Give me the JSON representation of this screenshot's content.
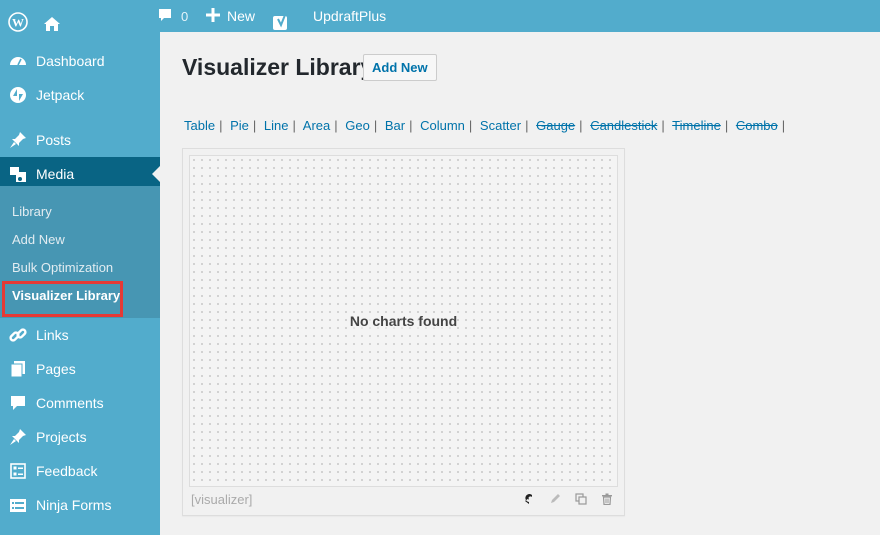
{
  "adminbar": {
    "comments_count": "0",
    "new_label": "New",
    "updraft_label": "UpdraftPlus"
  },
  "sidebar": {
    "items": [
      {
        "label": "Dashboard",
        "icon": "dashboard-icon"
      },
      {
        "label": "Jetpack",
        "icon": "jetpack-icon"
      },
      {
        "label": "Posts",
        "icon": "pin-icon"
      },
      {
        "label": "Media",
        "icon": "media-icon"
      },
      {
        "label": "Links",
        "icon": "link-icon"
      },
      {
        "label": "Pages",
        "icon": "pages-icon"
      },
      {
        "label": "Comments",
        "icon": "comment-icon"
      },
      {
        "label": "Projects",
        "icon": "pin-icon"
      },
      {
        "label": "Feedback",
        "icon": "feedback-icon"
      },
      {
        "label": "Ninja Forms",
        "icon": "forms-icon"
      }
    ],
    "submenu": [
      {
        "label": "Library"
      },
      {
        "label": "Add New"
      },
      {
        "label": "Bulk Optimization"
      },
      {
        "label": "Visualizer Library"
      }
    ]
  },
  "main": {
    "title": "Visualizer Library",
    "add_new_label": "Add New",
    "filters": [
      {
        "label": "Table",
        "enabled": true
      },
      {
        "label": "Pie",
        "enabled": true
      },
      {
        "label": "Line",
        "enabled": true
      },
      {
        "label": "Area",
        "enabled": true
      },
      {
        "label": "Geo",
        "enabled": true
      },
      {
        "label": "Bar",
        "enabled": true
      },
      {
        "label": "Column",
        "enabled": true
      },
      {
        "label": "Scatter",
        "enabled": true
      },
      {
        "label": "Gauge",
        "enabled": false
      },
      {
        "label": "Candlestick",
        "enabled": false
      },
      {
        "label": "Timeline",
        "enabled": false
      },
      {
        "label": "Combo",
        "enabled": false
      }
    ],
    "empty_message": "No charts found",
    "shortcode": "[visualizer]"
  }
}
